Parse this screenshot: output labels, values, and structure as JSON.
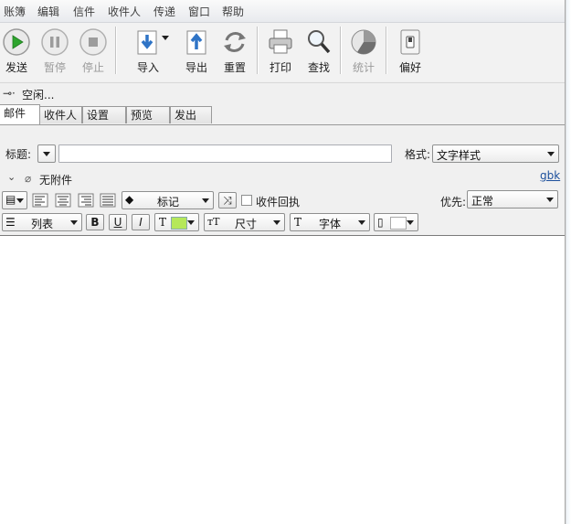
{
  "menu": [
    "账簿",
    "编辑",
    "信件",
    "收件人",
    "传递",
    "窗口",
    "帮助"
  ],
  "toolbar": {
    "send": "发送",
    "pause": "暂停",
    "stop": "停止",
    "import": "导入",
    "export": "导出",
    "reset": "重置",
    "print": "打印",
    "find": "查找",
    "stats": "统计",
    "prefs": "偏好"
  },
  "status": {
    "text": "空闲..."
  },
  "tabs": [
    "邮件",
    "收件人",
    "设置",
    "预览",
    "发出"
  ],
  "form": {
    "subject_label": "标题:",
    "subject_value": "",
    "format_label": "格式:",
    "format_value": "文字样式",
    "attachments": "无附件",
    "charset": "gbk",
    "tag_value": "标记",
    "receipt_label": "收件回执",
    "priority_label": "优先:",
    "priority_value": "正常",
    "list_value": "列表",
    "bold": "B",
    "underline": "U",
    "italic": "I",
    "text_color_letter": "T",
    "text_color": "#b5e85a",
    "size_value": "尺寸",
    "font_value": "字体"
  },
  "colors": {
    "send_green": "#2ea52e",
    "accent_blue": "#2f74c6"
  }
}
